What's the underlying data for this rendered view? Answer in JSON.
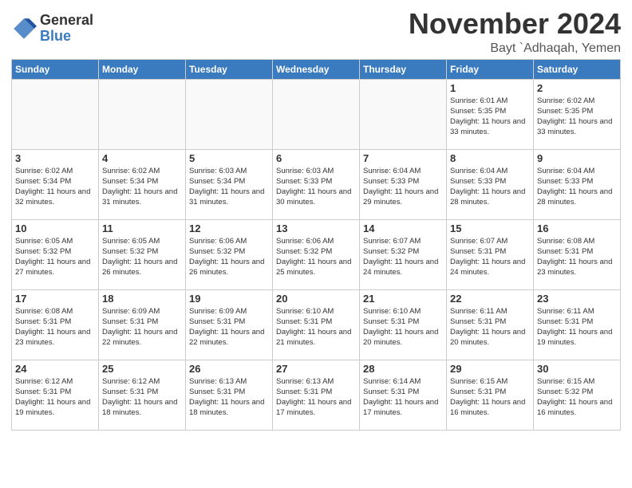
{
  "header": {
    "logo_general": "General",
    "logo_blue": "Blue",
    "month_title": "November 2024",
    "location": "Bayt `Adhaqah, Yemen"
  },
  "weekdays": [
    "Sunday",
    "Monday",
    "Tuesday",
    "Wednesday",
    "Thursday",
    "Friday",
    "Saturday"
  ],
  "weeks": [
    [
      {
        "day": "",
        "empty": true
      },
      {
        "day": "",
        "empty": true
      },
      {
        "day": "",
        "empty": true
      },
      {
        "day": "",
        "empty": true
      },
      {
        "day": "",
        "empty": true
      },
      {
        "day": "1",
        "sunrise": "6:01 AM",
        "sunset": "5:35 PM",
        "daylight": "11 hours and 33 minutes."
      },
      {
        "day": "2",
        "sunrise": "6:02 AM",
        "sunset": "5:35 PM",
        "daylight": "11 hours and 33 minutes."
      }
    ],
    [
      {
        "day": "3",
        "sunrise": "6:02 AM",
        "sunset": "5:34 PM",
        "daylight": "11 hours and 32 minutes."
      },
      {
        "day": "4",
        "sunrise": "6:02 AM",
        "sunset": "5:34 PM",
        "daylight": "11 hours and 31 minutes."
      },
      {
        "day": "5",
        "sunrise": "6:03 AM",
        "sunset": "5:34 PM",
        "daylight": "11 hours and 31 minutes."
      },
      {
        "day": "6",
        "sunrise": "6:03 AM",
        "sunset": "5:33 PM",
        "daylight": "11 hours and 30 minutes."
      },
      {
        "day": "7",
        "sunrise": "6:04 AM",
        "sunset": "5:33 PM",
        "daylight": "11 hours and 29 minutes."
      },
      {
        "day": "8",
        "sunrise": "6:04 AM",
        "sunset": "5:33 PM",
        "daylight": "11 hours and 28 minutes."
      },
      {
        "day": "9",
        "sunrise": "6:04 AM",
        "sunset": "5:33 PM",
        "daylight": "11 hours and 28 minutes."
      }
    ],
    [
      {
        "day": "10",
        "sunrise": "6:05 AM",
        "sunset": "5:32 PM",
        "daylight": "11 hours and 27 minutes."
      },
      {
        "day": "11",
        "sunrise": "6:05 AM",
        "sunset": "5:32 PM",
        "daylight": "11 hours and 26 minutes."
      },
      {
        "day": "12",
        "sunrise": "6:06 AM",
        "sunset": "5:32 PM",
        "daylight": "11 hours and 26 minutes."
      },
      {
        "day": "13",
        "sunrise": "6:06 AM",
        "sunset": "5:32 PM",
        "daylight": "11 hours and 25 minutes."
      },
      {
        "day": "14",
        "sunrise": "6:07 AM",
        "sunset": "5:32 PM",
        "daylight": "11 hours and 24 minutes."
      },
      {
        "day": "15",
        "sunrise": "6:07 AM",
        "sunset": "5:31 PM",
        "daylight": "11 hours and 24 minutes."
      },
      {
        "day": "16",
        "sunrise": "6:08 AM",
        "sunset": "5:31 PM",
        "daylight": "11 hours and 23 minutes."
      }
    ],
    [
      {
        "day": "17",
        "sunrise": "6:08 AM",
        "sunset": "5:31 PM",
        "daylight": "11 hours and 23 minutes."
      },
      {
        "day": "18",
        "sunrise": "6:09 AM",
        "sunset": "5:31 PM",
        "daylight": "11 hours and 22 minutes."
      },
      {
        "day": "19",
        "sunrise": "6:09 AM",
        "sunset": "5:31 PM",
        "daylight": "11 hours and 22 minutes."
      },
      {
        "day": "20",
        "sunrise": "6:10 AM",
        "sunset": "5:31 PM",
        "daylight": "11 hours and 21 minutes."
      },
      {
        "day": "21",
        "sunrise": "6:10 AM",
        "sunset": "5:31 PM",
        "daylight": "11 hours and 20 minutes."
      },
      {
        "day": "22",
        "sunrise": "6:11 AM",
        "sunset": "5:31 PM",
        "daylight": "11 hours and 20 minutes."
      },
      {
        "day": "23",
        "sunrise": "6:11 AM",
        "sunset": "5:31 PM",
        "daylight": "11 hours and 19 minutes."
      }
    ],
    [
      {
        "day": "24",
        "sunrise": "6:12 AM",
        "sunset": "5:31 PM",
        "daylight": "11 hours and 19 minutes."
      },
      {
        "day": "25",
        "sunrise": "6:12 AM",
        "sunset": "5:31 PM",
        "daylight": "11 hours and 18 minutes."
      },
      {
        "day": "26",
        "sunrise": "6:13 AM",
        "sunset": "5:31 PM",
        "daylight": "11 hours and 18 minutes."
      },
      {
        "day": "27",
        "sunrise": "6:13 AM",
        "sunset": "5:31 PM",
        "daylight": "11 hours and 17 minutes."
      },
      {
        "day": "28",
        "sunrise": "6:14 AM",
        "sunset": "5:31 PM",
        "daylight": "11 hours and 17 minutes."
      },
      {
        "day": "29",
        "sunrise": "6:15 AM",
        "sunset": "5:31 PM",
        "daylight": "11 hours and 16 minutes."
      },
      {
        "day": "30",
        "sunrise": "6:15 AM",
        "sunset": "5:32 PM",
        "daylight": "11 hours and 16 minutes."
      }
    ]
  ]
}
